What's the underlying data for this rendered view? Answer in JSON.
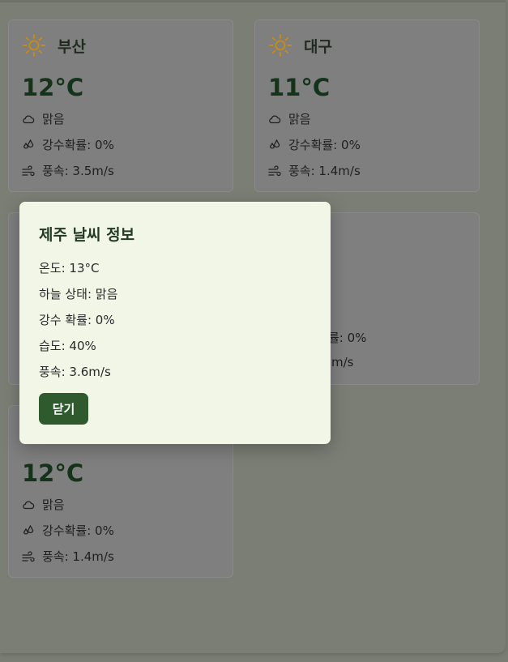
{
  "cards": [
    {
      "city": "부산",
      "temp": "12°C",
      "sky": "맑음",
      "rain": "강수확률: 0%",
      "wind": "풍속: 3.5m/s"
    },
    {
      "city": "대구",
      "temp": "11°C",
      "sky": "맑음",
      "rain": "강수확률: 0%",
      "wind": "풍속: 1.4m/s"
    },
    {
      "city": "",
      "temp": "",
      "sky": "",
      "rain": "",
      "wind": ""
    },
    {
      "city": "",
      "temp": "",
      "sky": "",
      "rain": "률: 0%",
      "wind": "m/s"
    },
    {
      "city": "",
      "temp": "12°C",
      "sky": "맑음",
      "rain": "강수확률: 0%",
      "wind": "풍속: 1.4m/s"
    }
  ],
  "modal": {
    "title": "제주 날씨 정보",
    "temp": "온도: 13°C",
    "sky": "하늘 상태: 맑음",
    "rain": "강수 확률: 0%",
    "humidity": "습도: 40%",
    "wind": "풍속: 3.6m/s",
    "close_label": "닫기"
  },
  "colors": {
    "sun": "#c58b14",
    "accent": "#2e5a2d",
    "modal_bg": "#f1f6e7"
  },
  "icons": {
    "weather": "sun-icon",
    "sky": "cloud-icon",
    "rain": "droplets-icon",
    "wind": "wind-icon"
  }
}
